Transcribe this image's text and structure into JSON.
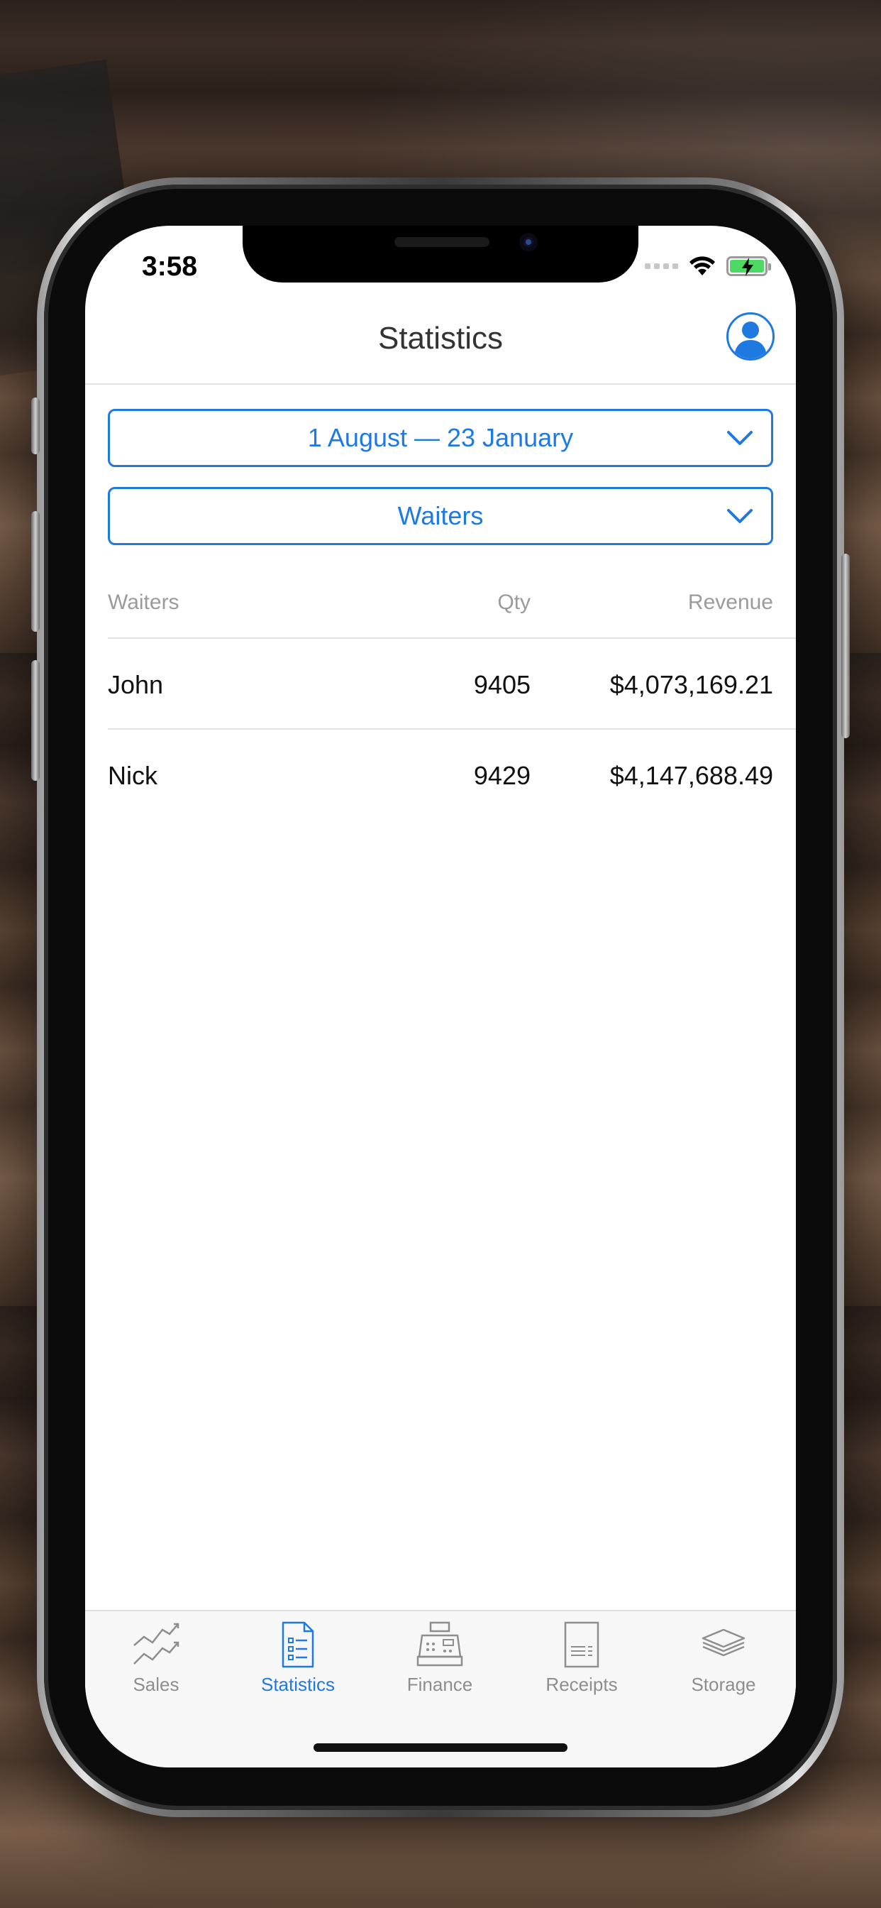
{
  "status": {
    "time": "3:58"
  },
  "nav": {
    "title": "Statistics"
  },
  "filters": {
    "date_range": "1 August — 23 January",
    "group_by": "Waiters"
  },
  "table": {
    "headers": {
      "name": "Waiters",
      "qty": "Qty",
      "revenue": "Revenue"
    },
    "rows": [
      {
        "name": "John",
        "qty": "9405",
        "revenue": "$4,073,169.21"
      },
      {
        "name": "Nick",
        "qty": "9429",
        "revenue": "$4,147,688.49"
      }
    ]
  },
  "tabs": [
    {
      "label": "Sales",
      "icon": "chart-line-icon",
      "active": false
    },
    {
      "label": "Statistics",
      "icon": "document-list-icon",
      "active": true
    },
    {
      "label": "Finance",
      "icon": "cash-register-icon",
      "active": false
    },
    {
      "label": "Receipts",
      "icon": "receipt-icon",
      "active": false
    },
    {
      "label": "Storage",
      "icon": "stack-layers-icon",
      "active": false
    }
  ],
  "colors": {
    "accent": "#1e7ae0",
    "inactive": "#8e8e8e",
    "battery": "#4cd964"
  }
}
